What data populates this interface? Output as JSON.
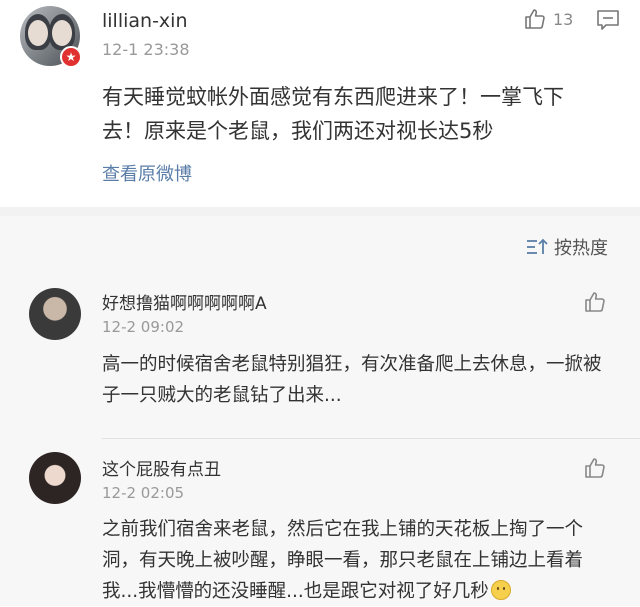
{
  "post": {
    "username": "lillian-xin",
    "time": "12-1 23:38",
    "like_count": "13",
    "text": "有天睡觉蚊帐外面感觉有东西爬进来了！一掌飞下去！原来是个老鼠，我们两还对视长达5秒",
    "view_original": "查看原微博",
    "vip_badge_icon": "star-badge-icon",
    "accent_color": "#5b7ea8"
  },
  "comments_section": {
    "sort_label": "按热度",
    "background": "#f7f7f7",
    "items": [
      {
        "username": "好想撸猫啊啊啊啊啊A",
        "time": "12-2 09:02",
        "text": "高一的时候宿舍老鼠特别猖狂，有次准备爬上去休息，一掀被子一只贼大的老鼠钻了出来..."
      },
      {
        "username": "这个屁股有点丑",
        "time": "12-2 02:05",
        "text": "之前我们宿舍来老鼠，然后它在我上铺的天花板上掏了一个洞，有天晚上被吵醒，睁眼一看，那只老鼠在上铺边上看着我...我懵懵的还没睡醒...也是跟它对视了好几秒"
      }
    ]
  }
}
